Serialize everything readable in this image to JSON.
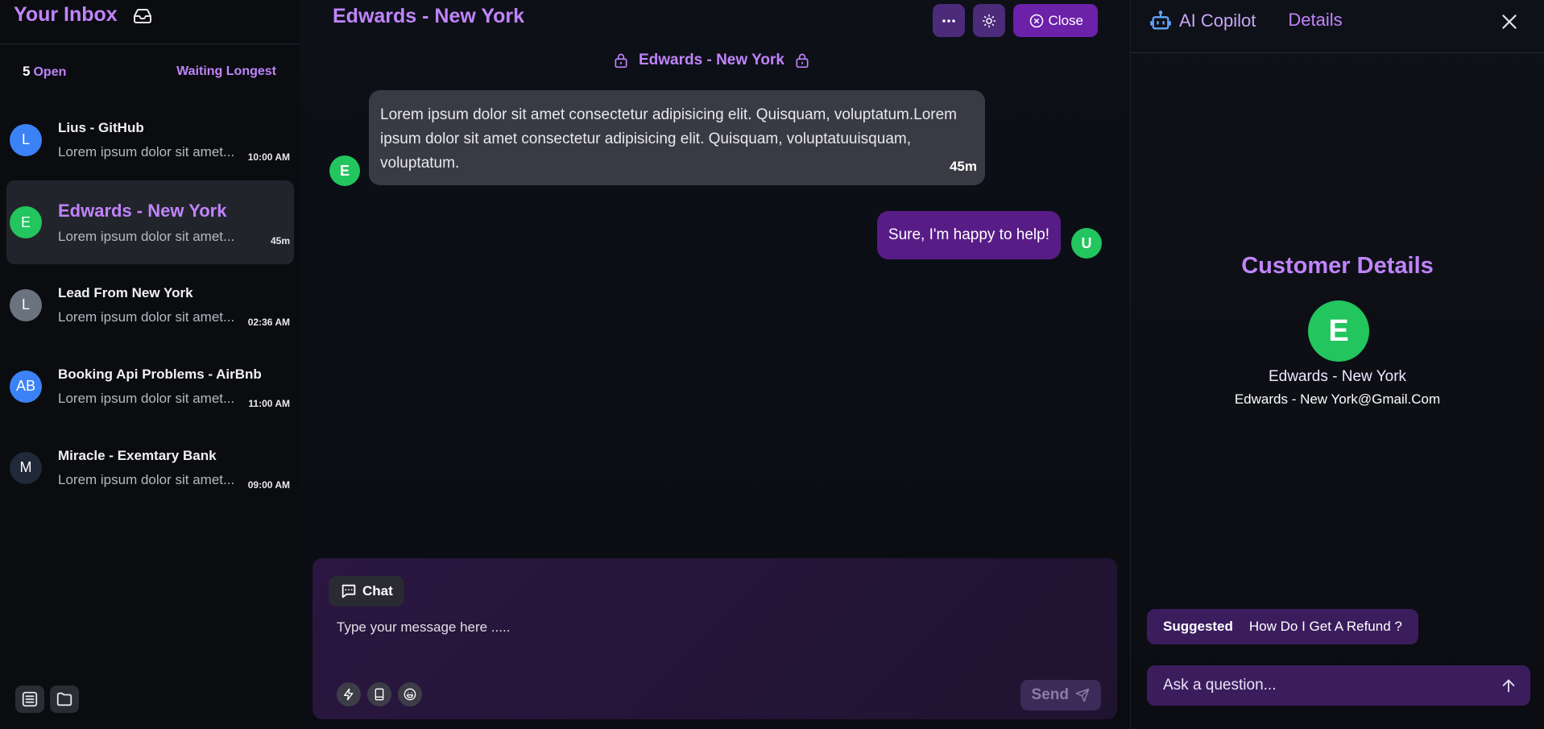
{
  "sidebar": {
    "title": "Your Inbox",
    "open_count": "5",
    "open_label": "Open",
    "sort_label": "Waiting Longest",
    "conversations": [
      {
        "initials": "L",
        "name": "Lius - GitHub",
        "preview": "Lorem ipsum dolor sit amet...",
        "time": "10:00 AM",
        "color": "#3b82f6"
      },
      {
        "initials": "E",
        "name": "Edwards - New York",
        "preview": "Lorem ipsum dolor sit amet...",
        "time": "45m",
        "color": "#22c55e"
      },
      {
        "initials": "L",
        "name": "Lead From New York",
        "preview": "Lorem ipsum dolor sit amet...",
        "time": "02:36 AM",
        "color": "#6b7280"
      },
      {
        "initials": "AB",
        "name": "Booking Api Problems - AirBnb",
        "preview": "Lorem ipsum dolor sit amet...",
        "time": "11:00 AM",
        "color": "#3b82f6"
      },
      {
        "initials": "M",
        "name": "Miracle - Exemtary Bank",
        "preview": "Lorem ipsum dolor sit amet...",
        "time": "09:00 AM",
        "color": "#1f2937"
      }
    ]
  },
  "chat": {
    "title": "Edwards - New York",
    "close_label": "Close",
    "lock_title": "Edwards - New York",
    "incoming": {
      "avatar": "E",
      "text": "Lorem ipsum dolor sit amet consectetur adipisicing elit. Quisquam, voluptatum.Lorem ipsum dolor sit amet consectetur adipisicing elit. Quisquam, voluptatuuisquam, voluptatum.",
      "time": "45m"
    },
    "outgoing": {
      "avatar": "U",
      "text": "Sure, I'm happy to help!"
    },
    "composer": {
      "tab_label": "Chat",
      "placeholder": "Type your message here .....",
      "send_label": "Send"
    }
  },
  "right_panel": {
    "tab_copilot": "AI Copilot",
    "tab_details": "Details",
    "section_title": "Customer Details",
    "avatar": "E",
    "name": "Edwards - New York",
    "email": "Edwards - New York@Gmail.Com",
    "suggested_label": "Suggested",
    "suggested_question": "How Do I Get A Refund ?",
    "ask_placeholder": "Ask a question..."
  },
  "colors": {
    "accent": "#c084fc",
    "primary_button": "#6b21a8",
    "green": "#22c55e"
  }
}
